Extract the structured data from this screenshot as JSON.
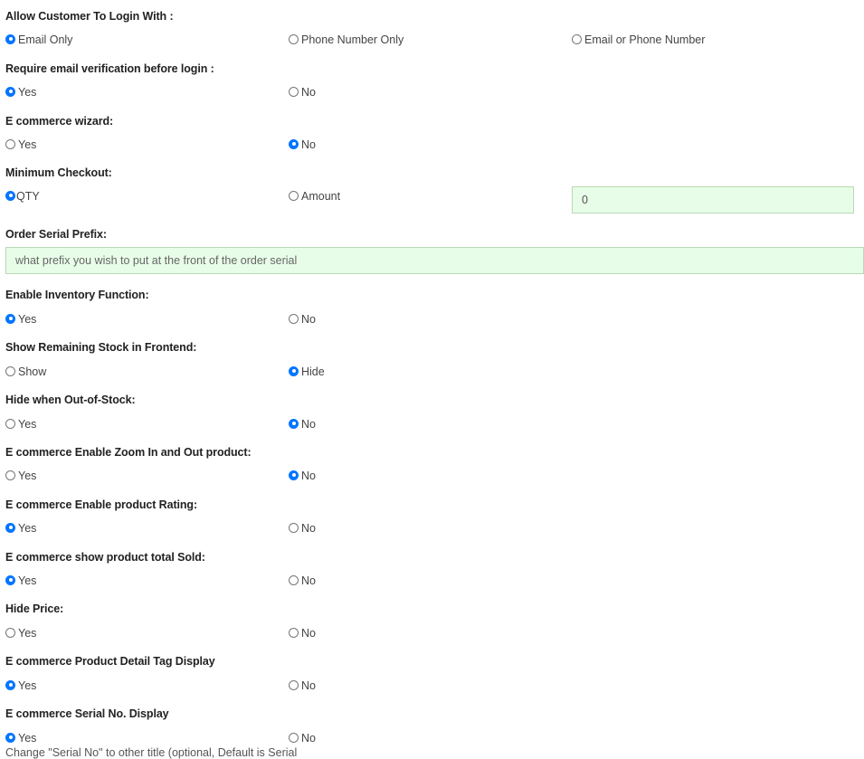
{
  "login_with": {
    "heading": "Allow Customer To Login With :",
    "options": [
      "Email Only",
      "Phone Number Only",
      "Email or Phone Number"
    ],
    "selected": "Email Only"
  },
  "email_verification": {
    "heading": "Require email verification before login :",
    "options": [
      "Yes",
      "No"
    ],
    "selected": "Yes"
  },
  "wizard": {
    "heading": "E commerce wizard:",
    "options": [
      "Yes",
      "No"
    ],
    "selected": "No"
  },
  "minimum_checkout": {
    "heading": "Minimum Checkout:",
    "options": [
      "QTY",
      "Amount"
    ],
    "selected": "QTY",
    "value": "0"
  },
  "order_serial_prefix": {
    "heading": "Order Serial Prefix:",
    "placeholder": "what prefix you wish to put at the front of the order serial"
  },
  "inventory": {
    "heading": "Enable Inventory Function:",
    "options": [
      "Yes",
      "No"
    ],
    "selected": "Yes"
  },
  "remaining_stock": {
    "heading": "Show Remaining Stock in Frontend:",
    "options": [
      "Show",
      "Hide"
    ],
    "selected": "Hide"
  },
  "hide_out_of_stock": {
    "heading": "Hide when Out-of-Stock:",
    "options": [
      "Yes",
      "No"
    ],
    "selected": "No"
  },
  "zoom": {
    "heading": "E commerce Enable Zoom In and Out product:",
    "options": [
      "Yes",
      "No"
    ],
    "selected": "No"
  },
  "rating": {
    "heading": "E commerce Enable product Rating:",
    "options": [
      "Yes",
      "No"
    ],
    "selected": "Yes"
  },
  "total_sold": {
    "heading": "E commerce show product total Sold:",
    "options": [
      "Yes",
      "No"
    ],
    "selected": "Yes"
  },
  "hide_price": {
    "heading": "Hide Price:",
    "options": [
      "Yes",
      "No"
    ],
    "selected": ""
  },
  "tag_display": {
    "heading": "E commerce Product Detail Tag Display",
    "options": [
      "Yes",
      "No"
    ],
    "selected": "Yes"
  },
  "serial_display": {
    "heading": "E commerce Serial No. Display",
    "options": [
      "Yes",
      "No"
    ],
    "selected": "Yes",
    "note": "Change \"Serial No\" to other title (optional, Default is Serial"
  }
}
